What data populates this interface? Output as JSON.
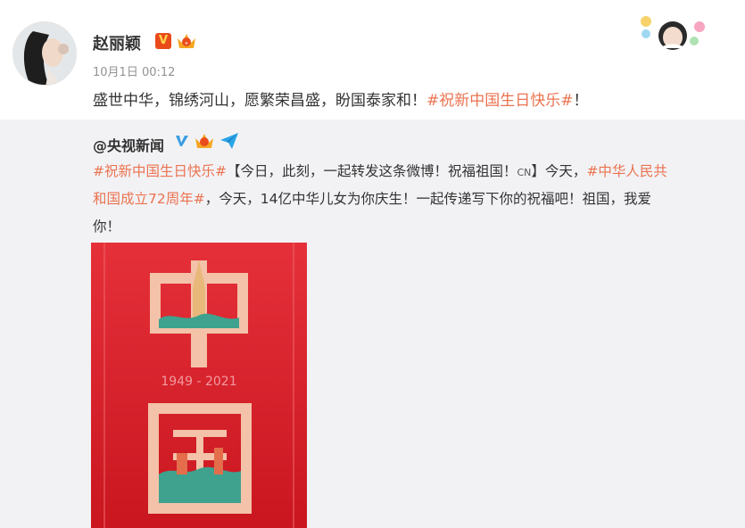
{
  "post": {
    "author_name": "赵丽颖",
    "time": "10月1日 00:12",
    "text_main": "盛世中华，锦绣河山，愿繁荣昌盛，盼国泰家和！",
    "text_topic": "#祝新中国生日快乐#",
    "text_end": "！",
    "verified_label": "V"
  },
  "repost": {
    "author": "@央视新闻",
    "line1_topic1": "#祝新中国生日快乐#",
    "line1_text": "【今日，此刻，一起转发这条微博！祝福祖国！",
    "line1_cn": "CN",
    "line1_text2": "】今天，",
    "line1_topic2": "#中华人民共",
    "line2_topic2": "和国成立72周年#",
    "line2_text": "，今天，14亿中华儿女为你庆生！一起传递写下你的祝福吧！祖国，我爱",
    "line3_text": "你！"
  },
  "poster": {
    "years": "1949 - 2021",
    "char_top": "中",
    "char_bottom": "国",
    "bg_color": "#d8202a"
  },
  "icons": {
    "verified": "verified-v-icon",
    "crown": "crown-badge-icon",
    "plane": "paper-plane-icon"
  }
}
